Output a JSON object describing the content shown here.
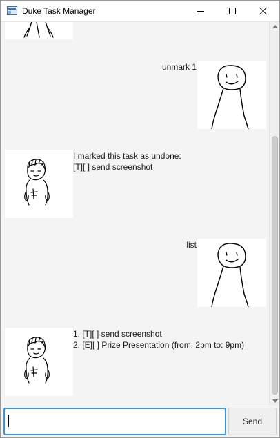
{
  "window": {
    "title": "Duke Task Manager"
  },
  "conversation": {
    "messages": [
      {
        "sender": "user",
        "lines": [
          "unmark 1"
        ]
      },
      {
        "sender": "duke",
        "lines": [
          "I marked this task as undone:",
          "[T][ ] send screenshot"
        ]
      },
      {
        "sender": "user",
        "lines": [
          "list"
        ]
      },
      {
        "sender": "duke",
        "lines": [
          "1. [T][ ] send screenshot",
          "2. [E][ ] Prize Presentation (from: 2pm to: 9pm)"
        ]
      }
    ]
  },
  "input_bar": {
    "value": "",
    "send_label": "Send"
  },
  "colors": {
    "input_focus_border": "#3c95d8",
    "chat_background": "#f4f4f4",
    "avatar_background": "#ffffff"
  },
  "icons": {
    "user_avatar": "smiling-figure-drawing",
    "duke_avatar": "duke-character-drawing"
  }
}
